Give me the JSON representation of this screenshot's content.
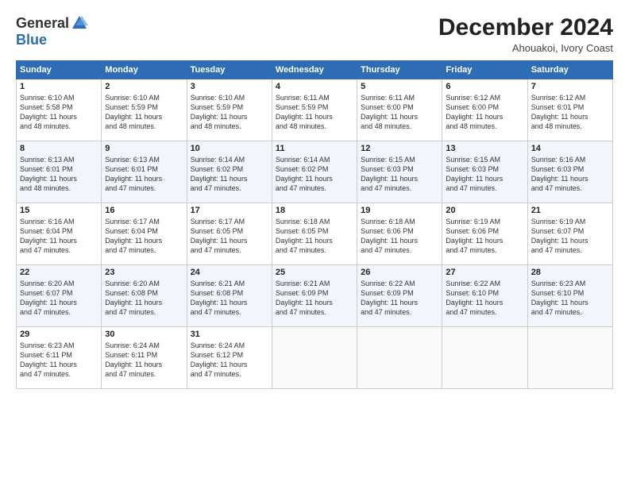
{
  "header": {
    "logo_general": "General",
    "logo_blue": "Blue",
    "month_title": "December 2024",
    "location": "Ahouakoi, Ivory Coast"
  },
  "days_of_week": [
    "Sunday",
    "Monday",
    "Tuesday",
    "Wednesday",
    "Thursday",
    "Friday",
    "Saturday"
  ],
  "weeks": [
    [
      {
        "day": "1",
        "sunrise": "6:10 AM",
        "sunset": "5:58 PM",
        "daylight": "11 hours and 48 minutes."
      },
      {
        "day": "2",
        "sunrise": "6:10 AM",
        "sunset": "5:59 PM",
        "daylight": "11 hours and 48 minutes."
      },
      {
        "day": "3",
        "sunrise": "6:10 AM",
        "sunset": "5:59 PM",
        "daylight": "11 hours and 48 minutes."
      },
      {
        "day": "4",
        "sunrise": "6:11 AM",
        "sunset": "5:59 PM",
        "daylight": "11 hours and 48 minutes."
      },
      {
        "day": "5",
        "sunrise": "6:11 AM",
        "sunset": "6:00 PM",
        "daylight": "11 hours and 48 minutes."
      },
      {
        "day": "6",
        "sunrise": "6:12 AM",
        "sunset": "6:00 PM",
        "daylight": "11 hours and 48 minutes."
      },
      {
        "day": "7",
        "sunrise": "6:12 AM",
        "sunset": "6:01 PM",
        "daylight": "11 hours and 48 minutes."
      }
    ],
    [
      {
        "day": "8",
        "sunrise": "6:13 AM",
        "sunset": "6:01 PM",
        "daylight": "11 hours and 48 minutes."
      },
      {
        "day": "9",
        "sunrise": "6:13 AM",
        "sunset": "6:01 PM",
        "daylight": "11 hours and 47 minutes."
      },
      {
        "day": "10",
        "sunrise": "6:14 AM",
        "sunset": "6:02 PM",
        "daylight": "11 hours and 47 minutes."
      },
      {
        "day": "11",
        "sunrise": "6:14 AM",
        "sunset": "6:02 PM",
        "daylight": "11 hours and 47 minutes."
      },
      {
        "day": "12",
        "sunrise": "6:15 AM",
        "sunset": "6:03 PM",
        "daylight": "11 hours and 47 minutes."
      },
      {
        "day": "13",
        "sunrise": "6:15 AM",
        "sunset": "6:03 PM",
        "daylight": "11 hours and 47 minutes."
      },
      {
        "day": "14",
        "sunrise": "6:16 AM",
        "sunset": "6:03 PM",
        "daylight": "11 hours and 47 minutes."
      }
    ],
    [
      {
        "day": "15",
        "sunrise": "6:16 AM",
        "sunset": "6:04 PM",
        "daylight": "11 hours and 47 minutes."
      },
      {
        "day": "16",
        "sunrise": "6:17 AM",
        "sunset": "6:04 PM",
        "daylight": "11 hours and 47 minutes."
      },
      {
        "day": "17",
        "sunrise": "6:17 AM",
        "sunset": "6:05 PM",
        "daylight": "11 hours and 47 minutes."
      },
      {
        "day": "18",
        "sunrise": "6:18 AM",
        "sunset": "6:05 PM",
        "daylight": "11 hours and 47 minutes."
      },
      {
        "day": "19",
        "sunrise": "6:18 AM",
        "sunset": "6:06 PM",
        "daylight": "11 hours and 47 minutes."
      },
      {
        "day": "20",
        "sunrise": "6:19 AM",
        "sunset": "6:06 PM",
        "daylight": "11 hours and 47 minutes."
      },
      {
        "day": "21",
        "sunrise": "6:19 AM",
        "sunset": "6:07 PM",
        "daylight": "11 hours and 47 minutes."
      }
    ],
    [
      {
        "day": "22",
        "sunrise": "6:20 AM",
        "sunset": "6:07 PM",
        "daylight": "11 hours and 47 minutes."
      },
      {
        "day": "23",
        "sunrise": "6:20 AM",
        "sunset": "6:08 PM",
        "daylight": "11 hours and 47 minutes."
      },
      {
        "day": "24",
        "sunrise": "6:21 AM",
        "sunset": "6:08 PM",
        "daylight": "11 hours and 47 minutes."
      },
      {
        "day": "25",
        "sunrise": "6:21 AM",
        "sunset": "6:09 PM",
        "daylight": "11 hours and 47 minutes."
      },
      {
        "day": "26",
        "sunrise": "6:22 AM",
        "sunset": "6:09 PM",
        "daylight": "11 hours and 47 minutes."
      },
      {
        "day": "27",
        "sunrise": "6:22 AM",
        "sunset": "6:10 PM",
        "daylight": "11 hours and 47 minutes."
      },
      {
        "day": "28",
        "sunrise": "6:23 AM",
        "sunset": "6:10 PM",
        "daylight": "11 hours and 47 minutes."
      }
    ],
    [
      {
        "day": "29",
        "sunrise": "6:23 AM",
        "sunset": "6:11 PM",
        "daylight": "11 hours and 47 minutes."
      },
      {
        "day": "30",
        "sunrise": "6:24 AM",
        "sunset": "6:11 PM",
        "daylight": "11 hours and 47 minutes."
      },
      {
        "day": "31",
        "sunrise": "6:24 AM",
        "sunset": "6:12 PM",
        "daylight": "11 hours and 47 minutes."
      },
      null,
      null,
      null,
      null
    ]
  ],
  "labels": {
    "sunrise": "Sunrise:",
    "sunset": "Sunset:",
    "daylight": "Daylight:"
  }
}
